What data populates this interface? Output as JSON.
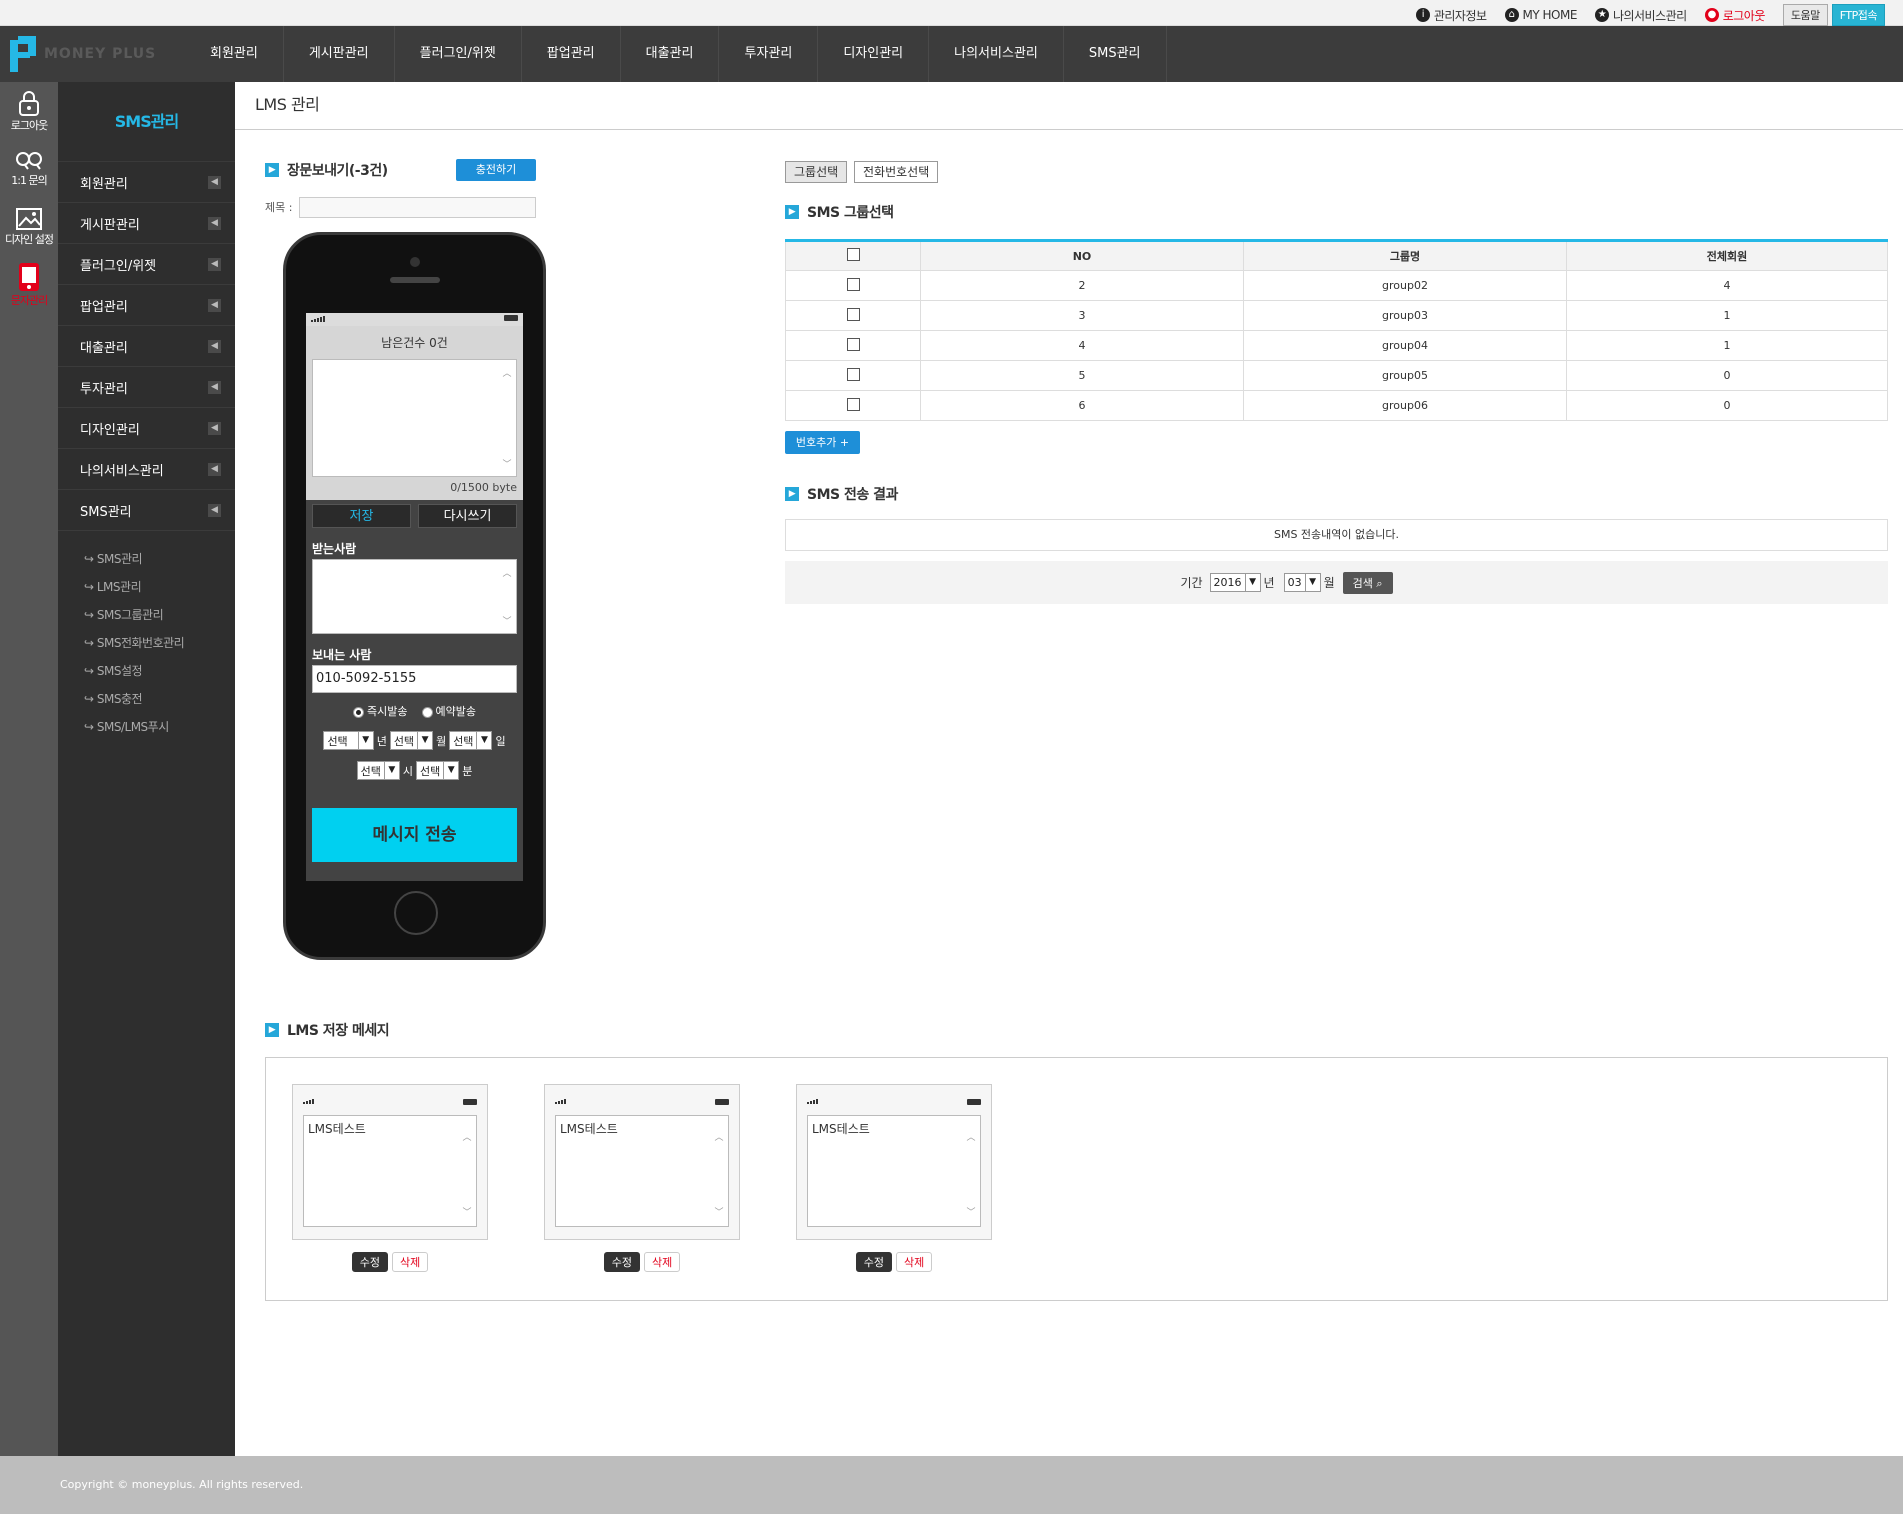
{
  "topbar": {
    "admin_info": "관리자정보",
    "my_home": "MY HOME",
    "my_service": "나의서비스관리",
    "logout": "로그아웃",
    "help": "도움말",
    "ftp": "FTP접속"
  },
  "logo": {
    "text": "MONEY PLUS"
  },
  "nav": {
    "items": [
      "회원관리",
      "게시판관리",
      "플러그인/위젯",
      "팝업관리",
      "대출관리",
      "투자관리",
      "디자인관리",
      "나의서비스관리",
      "SMS관리"
    ]
  },
  "iconbar": {
    "items": [
      {
        "label": "로그아웃",
        "icon": "lock-icon"
      },
      {
        "label": "1:1 문의",
        "icon": "chat-icon"
      },
      {
        "label": "디자인 설정",
        "icon": "image-icon"
      },
      {
        "label": "문자관리",
        "icon": "phone-icon"
      }
    ]
  },
  "sidebar": {
    "title": "SMS관리",
    "items": [
      "회원관리",
      "게시판관리",
      "플러그인/위젯",
      "팝업관리",
      "대출관리",
      "투자관리",
      "디자인관리",
      "나의서비스관리",
      "SMS관리"
    ],
    "sub_items": [
      "SMS관리",
      "LMS관리",
      "SMS그룹관리",
      "SMS전화번호관리",
      "SMS설정",
      "SMS충전",
      "SMS/LMS푸시"
    ]
  },
  "page": {
    "title": "LMS 관리"
  },
  "compose": {
    "heading": "장문보내기(-3건)",
    "charge_button": "충전하기",
    "subject_label": "제목 :",
    "subject_value": "",
    "remaining": "남은건수 0건",
    "byte_count": "0/1500 byte",
    "save": "저장",
    "rewrite": "다시쓰기",
    "receiver_label": "받는사람",
    "sender_label": "보내는 사람",
    "sender_value": "010-5092-5155",
    "radio_now": "즉시발송",
    "radio_reserve": "예약발송",
    "select_placeholder": "선택",
    "unit_year": "년",
    "unit_month": "월",
    "unit_day": "일",
    "unit_hour": "시",
    "unit_minute": "분",
    "send_button": "메시지 전송"
  },
  "group": {
    "tab_group": "그룹선택",
    "tab_phone": "전화번호선택",
    "heading": "SMS 그룹선택",
    "columns": [
      "NO",
      "그룹명",
      "전체회원"
    ],
    "rows": [
      {
        "no": "2",
        "name": "group02",
        "members": "4"
      },
      {
        "no": "3",
        "name": "group03",
        "members": "1"
      },
      {
        "no": "4",
        "name": "group04",
        "members": "1"
      },
      {
        "no": "5",
        "name": "group05",
        "members": "0"
      },
      {
        "no": "6",
        "name": "group06",
        "members": "0"
      }
    ],
    "add_button": "번호추가 +"
  },
  "result": {
    "heading": "SMS 전송 결과",
    "empty": "SMS 전송내역이 없습니다.",
    "period_label": "기간",
    "year": "2016",
    "year_unit": "년",
    "month": "03",
    "month_unit": "월",
    "search_button": "검색"
  },
  "stored": {
    "heading": "LMS 저장 메세지",
    "messages": [
      "LMS테스트",
      "LMS테스트",
      "LMS테스트"
    ],
    "edit": "수정",
    "delete": "삭제"
  },
  "footer": {
    "copyright": "Copyright © moneyplus. All rights reserved."
  },
  "colors": {
    "accent": "#25b8e6",
    "send": "#00d0f0",
    "danger": "#e2001a",
    "nav_bg": "#3c3c3c",
    "side_bg": "#2e2e2e"
  }
}
